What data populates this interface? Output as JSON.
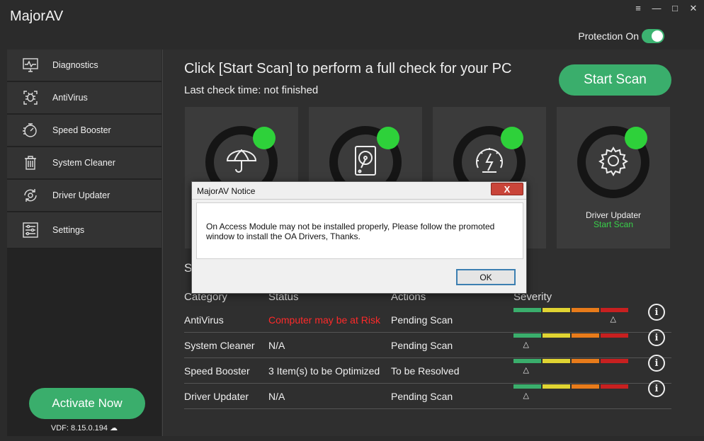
{
  "app": {
    "title": "MajorAV",
    "window_controls": [
      "≡",
      "—",
      "□",
      "✕"
    ]
  },
  "header": {
    "protection_label": "Protection On",
    "protection_on": true
  },
  "sidebar": {
    "items": [
      {
        "label": "Diagnostics",
        "icon": "monitor-pulse-icon"
      },
      {
        "label": "AntiVirus",
        "icon": "bug-icon"
      },
      {
        "label": "Speed Booster",
        "icon": "speedometer-icon"
      },
      {
        "label": "System Cleaner",
        "icon": "trash-icon"
      },
      {
        "label": "Driver Updater",
        "icon": "gear-refresh-icon"
      },
      {
        "label": "Settings",
        "icon": "sliders-icon"
      }
    ],
    "activate_label": "Activate Now",
    "vdf": "VDF: 8.15.0.194"
  },
  "main": {
    "headline": "Click [Start Scan] to perform a full check for your PC",
    "last_check": "Last check time: not finished",
    "start_scan_label": "Start Scan",
    "cards": [
      {
        "icon": "umbrella-icon",
        "name": "",
        "status": ""
      },
      {
        "icon": "harddisk-icon",
        "name": "",
        "status": ""
      },
      {
        "icon": "speed-gauge-icon",
        "name": "",
        "status": ""
      },
      {
        "icon": "gear-icon",
        "name": "Driver Updater",
        "status": "Start Scan"
      }
    ],
    "section_title": "S",
    "columns": {
      "category": "Category",
      "status": "Status",
      "actions": "Actions",
      "severity": "Severity"
    },
    "rows": [
      {
        "category": "AntiVirus",
        "status": "Computer may be at Risk",
        "status_color": "#ff2a2a",
        "action": "Pending Scan",
        "severity": 0.88
      },
      {
        "category": "System Cleaner",
        "status": "N/A",
        "status_color": "#f0f0f0",
        "action": "Pending Scan",
        "severity": 0.12
      },
      {
        "category": "Speed Booster",
        "status": "3 Item(s) to be Optimized",
        "status_color": "#f0f0f0",
        "action": "To be Resolved",
        "severity": 0.12
      },
      {
        "category": "Driver Updater",
        "status": "N/A",
        "status_color": "#f0f0f0",
        "action": "Pending Scan",
        "severity": 0.12
      }
    ],
    "severity_colors": [
      "#3aae6c",
      "#e0d432",
      "#e87b1a",
      "#c82020"
    ]
  },
  "dialog": {
    "title": "MajorAV Notice",
    "close_label": "X",
    "message": "On Access Module may not be installed properly, Please follow the promoted window to install the OA Drivers, Thanks.",
    "ok_label": "OK"
  }
}
